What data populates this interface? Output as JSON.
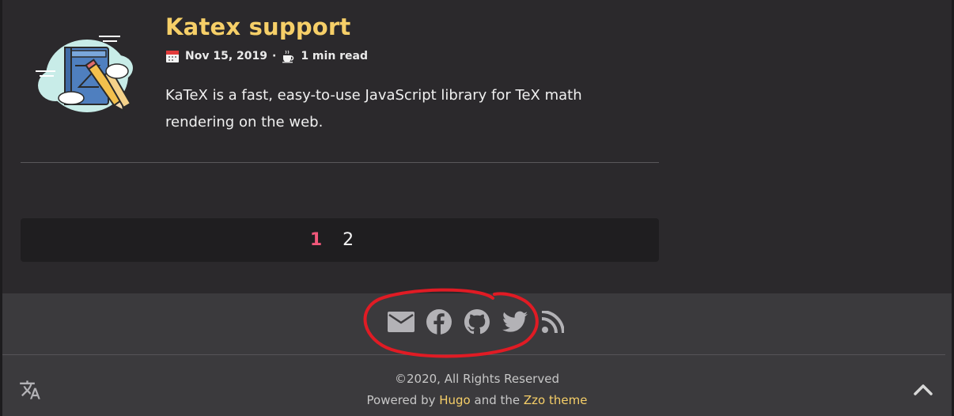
{
  "post": {
    "title": "Katex support",
    "date": "Nov 15, 2019",
    "separator": "·",
    "read_time": "1 min read",
    "excerpt": "KaTeX is a fast, easy-to-use JavaScript library for TeX math rendering on the web.",
    "thumbnail_icon": "book-pencil-cloud-illustration",
    "date_icon": "calendar-icon",
    "read_icon": "coffee-cup-icon"
  },
  "pagination": {
    "pages": [
      "1",
      "2"
    ],
    "current": "1"
  },
  "footer": {
    "social_icons": [
      "mail-icon",
      "facebook-icon",
      "github-icon",
      "twitter-icon",
      "rss-icon"
    ],
    "copyright": "©2020, All Rights Reserved",
    "powered_prefix": "Powered by ",
    "powered_hugo": "Hugo",
    "powered_mid": " and the ",
    "powered_theme": "Zzo theme"
  },
  "colors": {
    "accent_title": "#f6cf68",
    "current_page": "#f0587a",
    "annotation": "#e01b24"
  }
}
